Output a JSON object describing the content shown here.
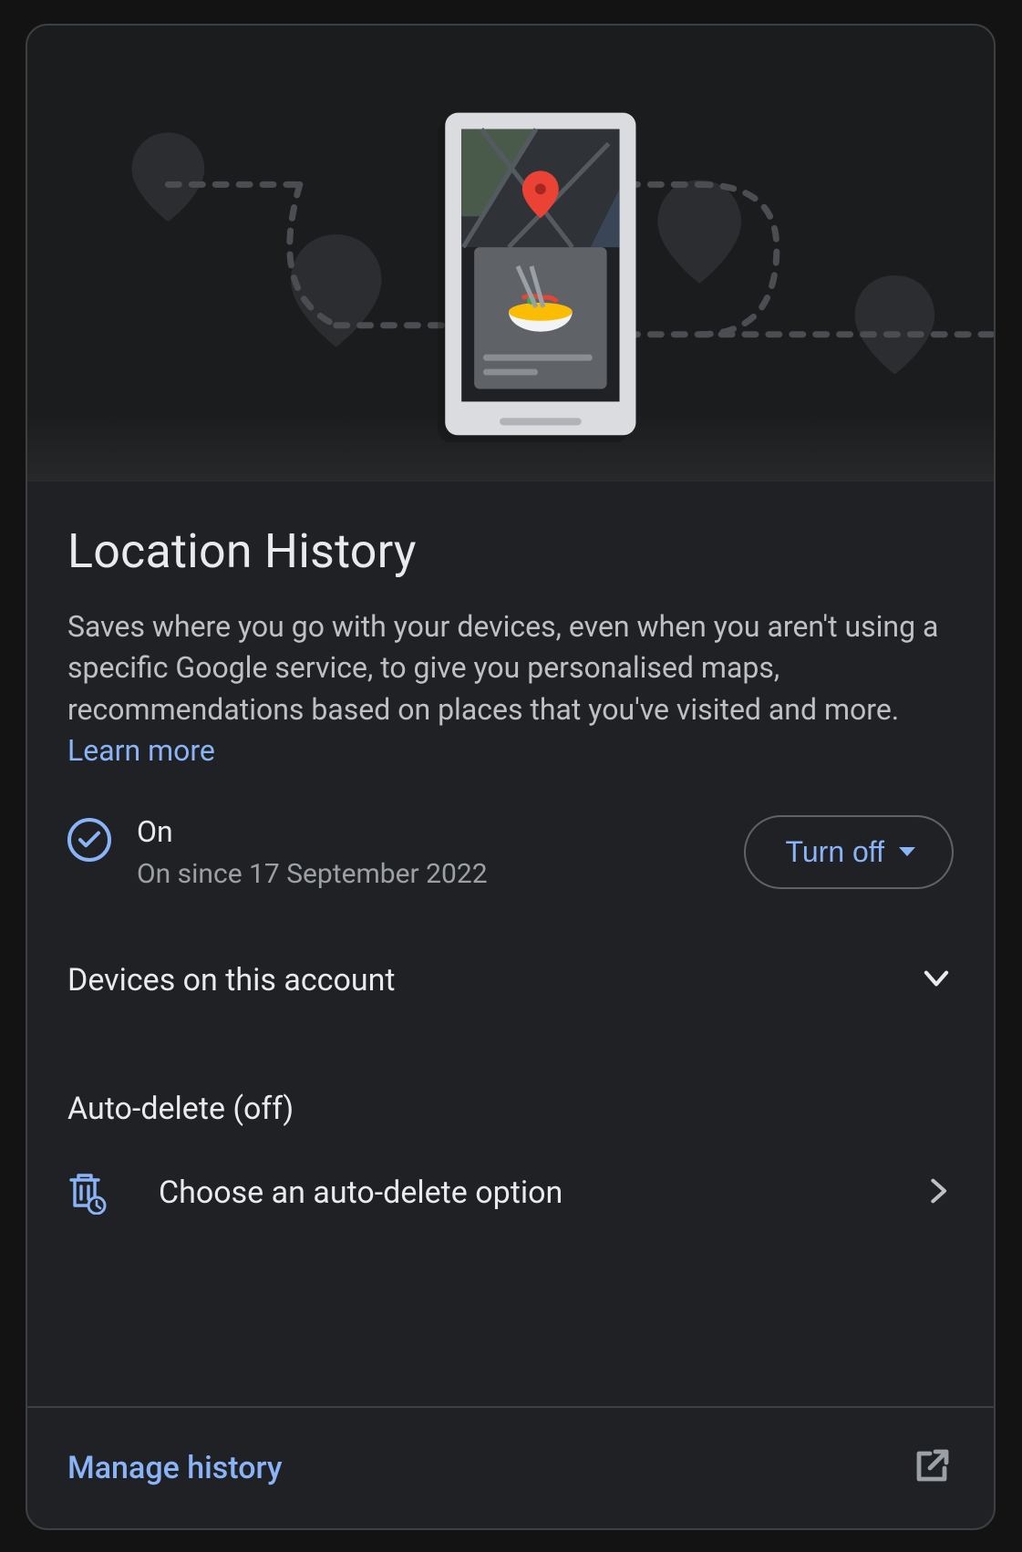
{
  "title": "Location History",
  "description_text": "Saves where you go with your devices, even when you aren't using a specific Google service, to give you personalised maps, recommendations based on places that you've visited and more. ",
  "learn_more_label": "Learn more",
  "status": {
    "on_label": "On",
    "since_label": "On since 17 September 2022",
    "turn_off_label": "Turn off"
  },
  "devices_label": "Devices on this account",
  "auto_delete": {
    "section_title": "Auto-delete (off)",
    "row_label": "Choose an auto-delete option"
  },
  "footer": {
    "manage_label": "Manage history"
  },
  "colors": {
    "accent": "#8ab4f8",
    "bg": "#202124",
    "border": "#3c4043",
    "text_secondary": "#9aa0a6"
  }
}
